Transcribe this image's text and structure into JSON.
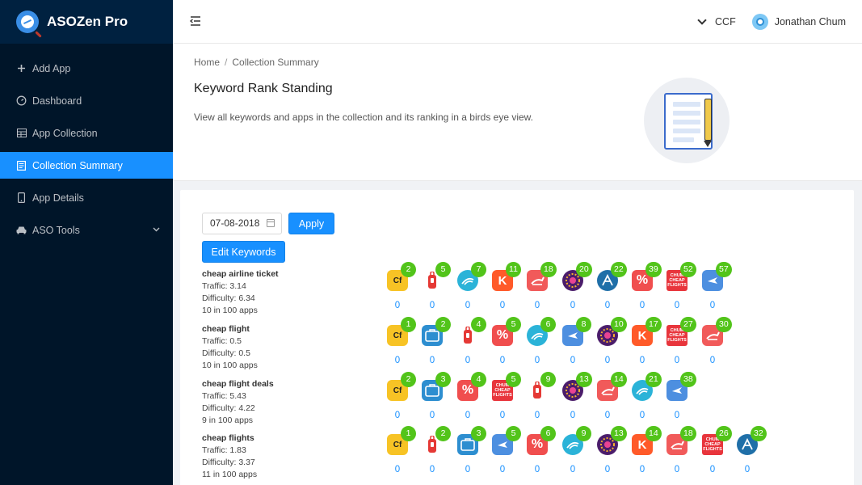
{
  "brand": {
    "title": "ASOZen Pro"
  },
  "sidebar": {
    "items": [
      {
        "label": "Add App",
        "icon": "plus-icon",
        "active": false
      },
      {
        "label": "Dashboard",
        "icon": "dashboard-icon",
        "active": false
      },
      {
        "label": "App Collection",
        "icon": "table-icon",
        "active": false
      },
      {
        "label": "Collection Summary",
        "icon": "file-text-icon",
        "active": true
      },
      {
        "label": "App Details",
        "icon": "mobile-icon",
        "active": false
      },
      {
        "label": "ASO Tools",
        "icon": "car-icon",
        "active": false,
        "expandable": true
      }
    ]
  },
  "header": {
    "org": "CCF",
    "user": "Jonathan Chum"
  },
  "breadcrumb": {
    "home": "Home",
    "sep": "/",
    "current": "Collection Summary"
  },
  "page": {
    "title": "Keyword Rank Standing",
    "description": "View all keywords and apps in the collection and its ranking in a birds eye view."
  },
  "filters": {
    "date": "07-08-2018",
    "apply_label": "Apply",
    "edit_label": "Edit Keywords"
  },
  "keywords": [
    {
      "name": "cheap airline ticket",
      "traffic": "Traffic: 3.14",
      "difficulty": "Difficulty: 6.34",
      "apps": "10 in 100 apps",
      "ranks": [
        {
          "app": "cf",
          "rank": "2",
          "change": "0"
        },
        {
          "app": "tag",
          "rank": "5",
          "change": "0"
        },
        {
          "app": "wifi",
          "rank": "7",
          "change": "0"
        },
        {
          "app": "kayak",
          "rank": "11",
          "change": "0"
        },
        {
          "app": "bunny",
          "rank": "18",
          "change": "0"
        },
        {
          "app": "purple",
          "rank": "20",
          "change": "0"
        },
        {
          "app": "ascent",
          "rank": "22",
          "change": "0"
        },
        {
          "app": "percent",
          "rank": "39",
          "change": "0"
        },
        {
          "app": "chum",
          "rank": "52",
          "change": "0"
        },
        {
          "app": "plane",
          "rank": "57",
          "change": "0"
        }
      ]
    },
    {
      "name": "cheap flight",
      "traffic": "Traffic: 0.5",
      "difficulty": "Difficulty: 0.5",
      "apps": "10 in 100 apps",
      "ranks": [
        {
          "app": "cf",
          "rank": "1",
          "change": "0"
        },
        {
          "app": "bag",
          "rank": "2",
          "change": "0"
        },
        {
          "app": "tag",
          "rank": "4",
          "change": "0"
        },
        {
          "app": "percent",
          "rank": "5",
          "change": "0"
        },
        {
          "app": "wifi",
          "rank": "6",
          "change": "0"
        },
        {
          "app": "plane",
          "rank": "8",
          "change": "0"
        },
        {
          "app": "purple",
          "rank": "10",
          "change": "0"
        },
        {
          "app": "kayak",
          "rank": "17",
          "change": "0"
        },
        {
          "app": "chum",
          "rank": "27",
          "change": "0"
        },
        {
          "app": "bunny",
          "rank": "30",
          "change": "0"
        }
      ]
    },
    {
      "name": "cheap flight deals",
      "traffic": "Traffic: 5.43",
      "difficulty": "Difficulty: 4.22",
      "apps": "9 in 100 apps",
      "ranks": [
        {
          "app": "cf",
          "rank": "2",
          "change": "0"
        },
        {
          "app": "bag",
          "rank": "3",
          "change": "0"
        },
        {
          "app": "percent",
          "rank": "4",
          "change": "0"
        },
        {
          "app": "chum",
          "rank": "5",
          "change": "0"
        },
        {
          "app": "tag",
          "rank": "9",
          "change": "0"
        },
        {
          "app": "purple",
          "rank": "13",
          "change": "0"
        },
        {
          "app": "bunny",
          "rank": "14",
          "change": "0"
        },
        {
          "app": "wifi",
          "rank": "21",
          "change": "0"
        },
        {
          "app": "plane",
          "rank": "38",
          "change": "0"
        }
      ]
    },
    {
      "name": "cheap flights",
      "traffic": "Traffic: 1.83",
      "difficulty": "Difficulty: 3.37",
      "apps": "11 in 100 apps",
      "ranks": [
        {
          "app": "cf",
          "rank": "1",
          "change": "0"
        },
        {
          "app": "tag",
          "rank": "2",
          "change": "0"
        },
        {
          "app": "bag",
          "rank": "3",
          "change": "0"
        },
        {
          "app": "plane",
          "rank": "5",
          "change": "0"
        },
        {
          "app": "percent",
          "rank": "6",
          "change": "0"
        },
        {
          "app": "wifi",
          "rank": "9",
          "change": "0"
        },
        {
          "app": "purple",
          "rank": "13",
          "change": "0"
        },
        {
          "app": "kayak",
          "rank": "14",
          "change": "0"
        },
        {
          "app": "bunny",
          "rank": "18",
          "change": "0"
        },
        {
          "app": "chum",
          "rank": "26",
          "change": "0"
        },
        {
          "app": "ascent",
          "rank": "32",
          "change": "0"
        }
      ]
    }
  ],
  "app_icons": {
    "cf": {
      "name": "cheapflights-cf-icon",
      "bg": "#f7c325",
      "text": "Cf"
    },
    "tag": {
      "name": "luggage-tag-icon",
      "bg": "#ffffff",
      "text": ""
    },
    "wifi": {
      "name": "wifi-wave-icon",
      "bg": "#2bb3d8",
      "text": ""
    },
    "kayak": {
      "name": "kayak-k-icon",
      "bg": "#ff5a29",
      "text": "K"
    },
    "bunny": {
      "name": "hopper-bunny-icon",
      "bg": "#f15a5a",
      "text": ""
    },
    "purple": {
      "name": "starburst-icon",
      "bg": "#4b1d6b",
      "text": ""
    },
    "ascent": {
      "name": "ascent-a-icon",
      "bg": "#1f6fa8",
      "text": ""
    },
    "percent": {
      "name": "percent-icon",
      "bg": "#f04e4e",
      "text": "%"
    },
    "chum": {
      "name": "chum-cheap-flights-icon",
      "bg": "#e8353c",
      "text": ""
    },
    "plane": {
      "name": "airplane-icon",
      "bg": "#4d8fe0",
      "text": ""
    },
    "bag": {
      "name": "travel-bag-icon",
      "bg": "#2d8ed0",
      "text": ""
    }
  }
}
